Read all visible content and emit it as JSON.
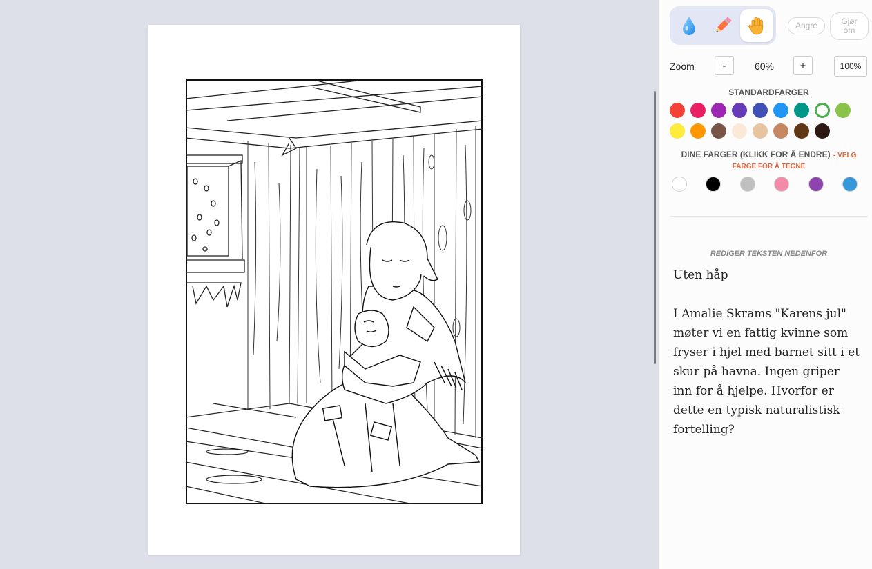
{
  "tools": [
    {
      "name": "fill",
      "icon": "water-drop-icon"
    },
    {
      "name": "pencil",
      "icon": "pencil-icon"
    },
    {
      "name": "pan",
      "icon": "hand-icon",
      "active": true
    }
  ],
  "undo_label": "Angre",
  "redo_label": "Gjør om",
  "zoom": {
    "label": "Zoom",
    "minus": "-",
    "value": "60%",
    "plus": "+",
    "reset": "100%"
  },
  "standard_colors_title": "STANDARDFARGER",
  "standard_colors": [
    "#f44336",
    "#e91e63",
    "#9c27b0",
    "#673ab7",
    "#3f51b5",
    "#2196f3",
    "#009688",
    "#4caf50",
    "#8bc34a",
    "#ffeb3b",
    "#ff9800",
    "#795548",
    "#fbe9d7",
    "#e8c3a0",
    "#c68863",
    "#603815",
    "#2e1a14"
  ],
  "selected_standard_color": "#4caf50",
  "my_colors_title": "DINE FARGER (KLIKK FOR Å ENDRE)",
  "my_colors_hint": "- VELG FARGE FOR Å TEGNE",
  "my_colors_hint_color": "#e8633a",
  "my_colors": [
    "#ffffff",
    "#000000",
    "#c0c0c0",
    "#f28aa8",
    "#8e44ad",
    "#3498db"
  ],
  "edit_label": "REDIGER TEKSTEN NEDENFOR",
  "text": "Uten håp\n\nI Amalie Skrams \"Karens jul\" møter vi en fattig kvinne som fryser i hjel med barnet sitt i et skur på havna. Ingen griper inn for å hjelpe. Hvorfor er dette en typisk naturalistisk fortelling?"
}
